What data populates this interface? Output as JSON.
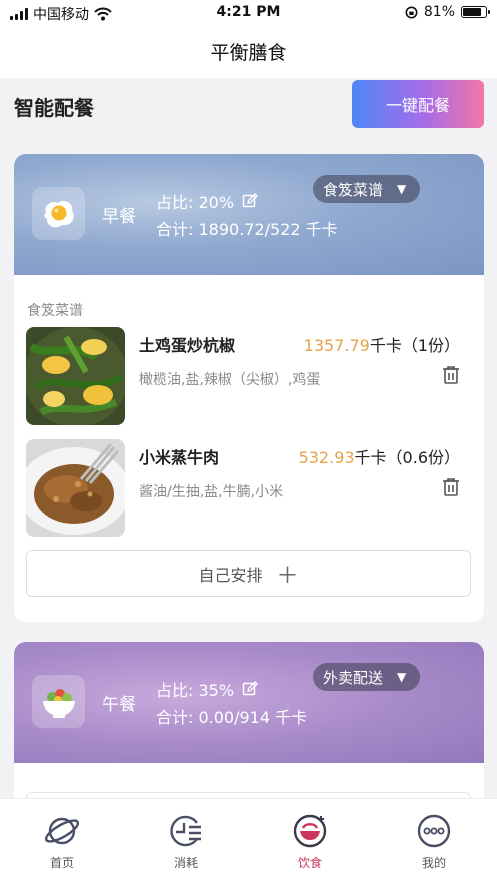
{
  "status_bar": {
    "carrier": "中国移动",
    "time": "4:21 PM",
    "battery": "81%",
    "battery_level": 0.81
  },
  "nav": {
    "title": "平衡膳食"
  },
  "header": {
    "section_title": "智能配餐",
    "one_key_button": "一键配餐"
  },
  "meals": [
    {
      "name": "早餐",
      "icon": "fried-egg-icon",
      "ratio": "占比: 20%",
      "total": "合计: 1890.72/522 千卡",
      "source": "食笈菜谱",
      "list_label": "食笈菜谱",
      "foods": [
        {
          "name": "土鸡蛋炒杭椒",
          "kcal": "1357.79",
          "kcal_suffix": "千卡（1份）",
          "ingredients": "橄榄油,盐,辣椒（尖椒）,鸡蛋"
        },
        {
          "name": "小米蒸牛肉",
          "kcal": "532.93",
          "kcal_suffix": "千卡（0.6份）",
          "ingredients": "酱油/生抽,盐,牛腩,小米"
        }
      ],
      "arrange_button": "自己安排"
    },
    {
      "name": "午餐",
      "icon": "salad-bowl-icon",
      "ratio": "占比: 35%",
      "total": "合计: 0.00/914 千卡",
      "source": "外卖配送"
    }
  ],
  "tabs": [
    {
      "label": "首页",
      "icon": "planet-icon",
      "active": false
    },
    {
      "label": "消耗",
      "icon": "clock-list-icon",
      "active": false
    },
    {
      "label": "饮食",
      "icon": "food-bowl-icon",
      "active": true
    },
    {
      "label": "我的",
      "icon": "more-dots-icon",
      "active": false
    }
  ],
  "colors": {
    "accent": "#c9365e",
    "kcal_number": "#e6a34c",
    "button_gradient_start": "#4f86f7",
    "button_gradient_end": "#f276a6"
  }
}
